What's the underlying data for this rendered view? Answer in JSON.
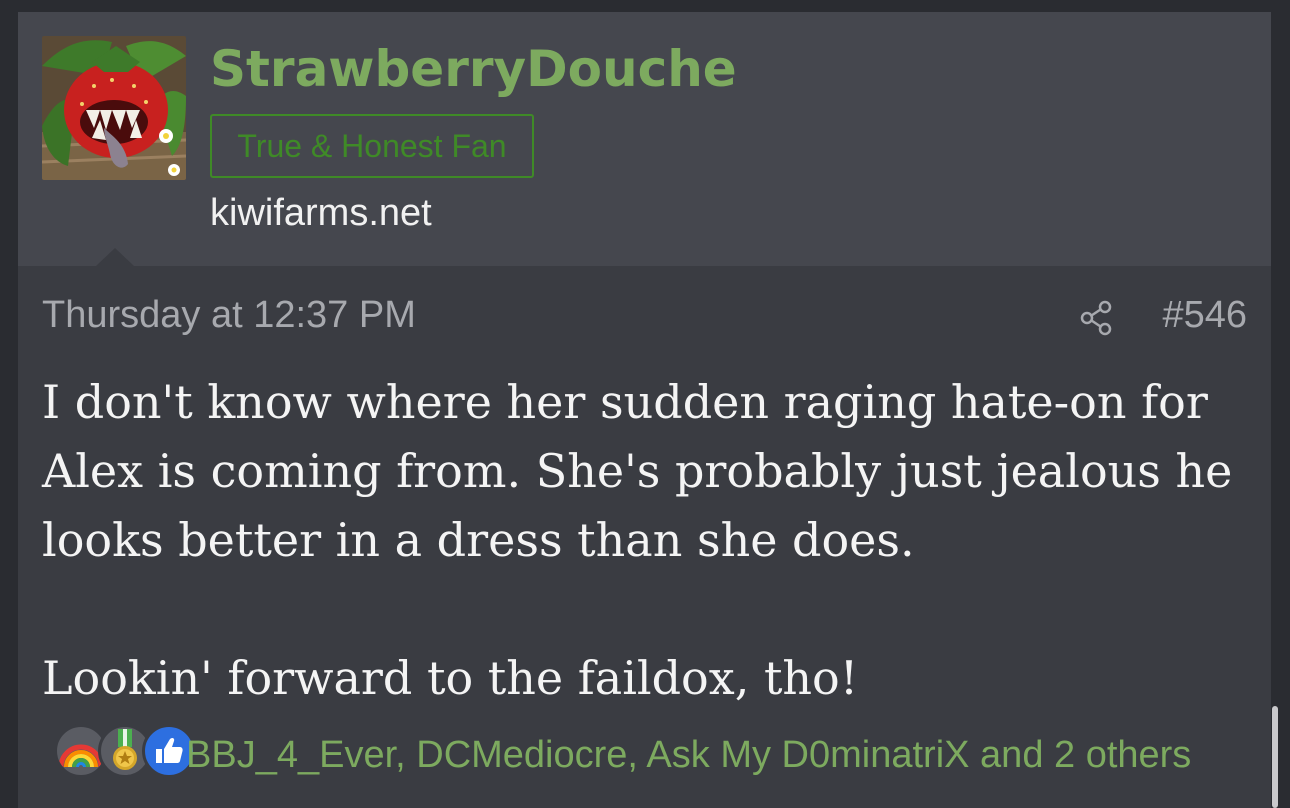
{
  "post": {
    "username": "StrawberryDouche",
    "user_title": "True & Honest Fan",
    "user_site": "kiwifarms.net",
    "date": "Thursday at 12:37 PM",
    "post_number": "#546",
    "message_lines": [
      "I don't know where her sudden raging hate-on for",
      "Alex is coming from. She's probably just jealous he",
      "looks better in a dress than she does.",
      "Lookin' forward to the faildox, tho!"
    ],
    "reactions": {
      "icons": [
        "rainbow-icon",
        "medal-icon",
        "like-icon"
      ],
      "users_text": "BBJ_4_Ever, DCMediocre, Ask My D0minatriX and 2 others"
    }
  },
  "colors": {
    "page_bg": "#2a2c31",
    "card_bg": "#3a3c42",
    "user_block_bg": "#45474e",
    "username": "#7daa5f",
    "title_border": "#3f8a27",
    "meta_text": "#a7a9ae",
    "message_text": "#f4f4f4"
  }
}
